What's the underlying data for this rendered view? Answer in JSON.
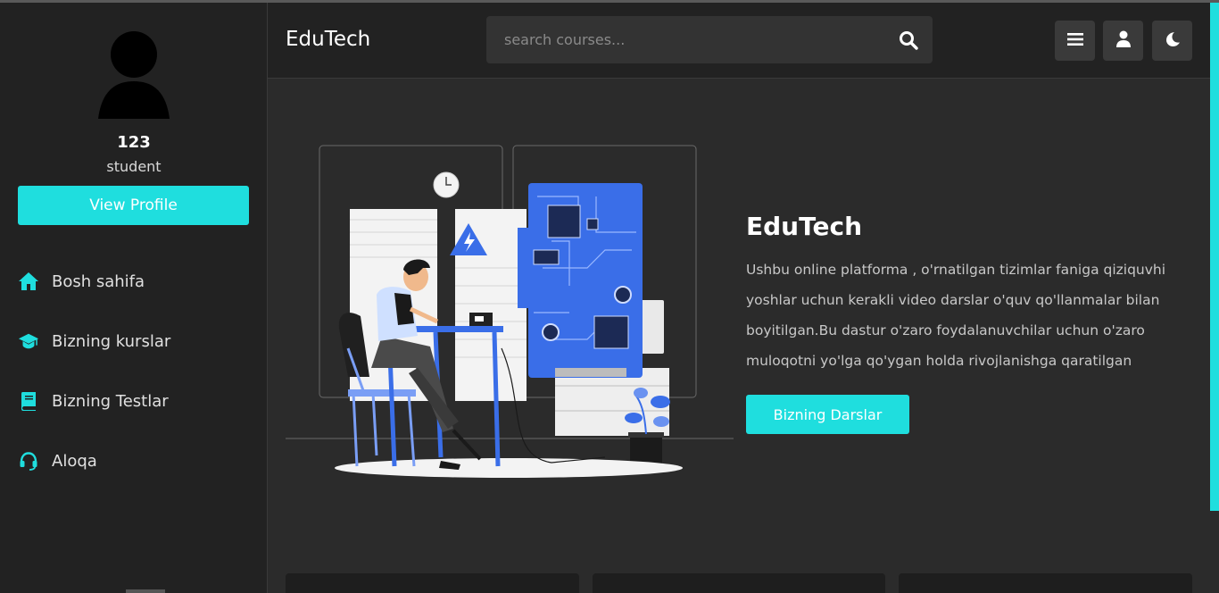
{
  "sidebar": {
    "user_name": "123",
    "user_role": "student",
    "view_profile_label": "View Profile",
    "nav": [
      {
        "label": "Bosh sahifa",
        "icon": "home-icon"
      },
      {
        "label": "Bizning kurslar",
        "icon": "graduation-cap-icon"
      },
      {
        "label": "Bizning Testlar",
        "icon": "book-icon"
      },
      {
        "label": "Aloqa",
        "icon": "headset-icon"
      }
    ]
  },
  "header": {
    "brand": "EduTech",
    "search_placeholder": "search courses...",
    "buttons": [
      "menu-icon",
      "user-icon",
      "moon-icon"
    ]
  },
  "hero": {
    "title": "EduTech",
    "description": "Ushbu online platforma , o'rnatilgan tizimlar faniga qiziquvhi yoshlar uchun kerakli video darslar o'quv qo'llanmalar bilan boyitilgan.Bu dastur o'zaro foydalanuvchilar uchun o'zaro muloqotni yo'lga qo'ygan holda rivojlanishga qaratilgan",
    "button_label": "Bizning Darslar"
  },
  "colors": {
    "accent": "#1fdede",
    "panel": "#222222",
    "background": "#2b2b2b",
    "illustration_blue": "#3a6ee8"
  }
}
